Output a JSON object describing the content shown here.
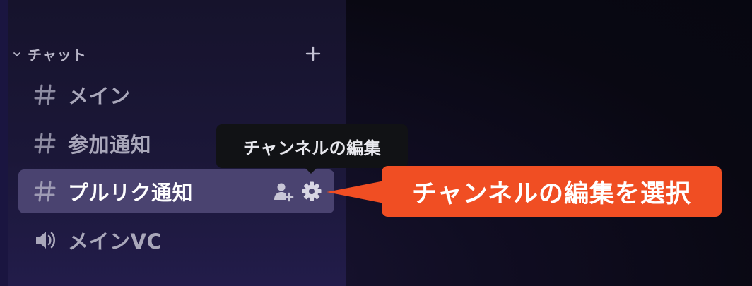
{
  "sidebar": {
    "category": {
      "label": "チャット",
      "chevron_icon": "chevron-down-icon",
      "add_icon": "plus-icon"
    },
    "channels": [
      {
        "label": "メイン",
        "icon": "text-channel-hash-icon",
        "selected": false
      },
      {
        "label": "参加通知",
        "icon": "text-channel-hash-icon",
        "selected": false
      },
      {
        "label": "プルリク通知",
        "icon": "text-channel-hash-icon",
        "selected": true,
        "actions": [
          "invite-user-icon",
          "gear-icon"
        ]
      },
      {
        "label": "メインVC",
        "icon": "speaker-icon",
        "selected": false
      }
    ]
  },
  "tooltip": {
    "text": "チャンネルの編集"
  },
  "callout": {
    "text": "チャンネルの編集を選択",
    "color": "#f04e23"
  },
  "colors": {
    "selected_bg": "#4a4370",
    "sidebar_bg": "#1b1738",
    "muted_text": "#a9a7ba"
  }
}
